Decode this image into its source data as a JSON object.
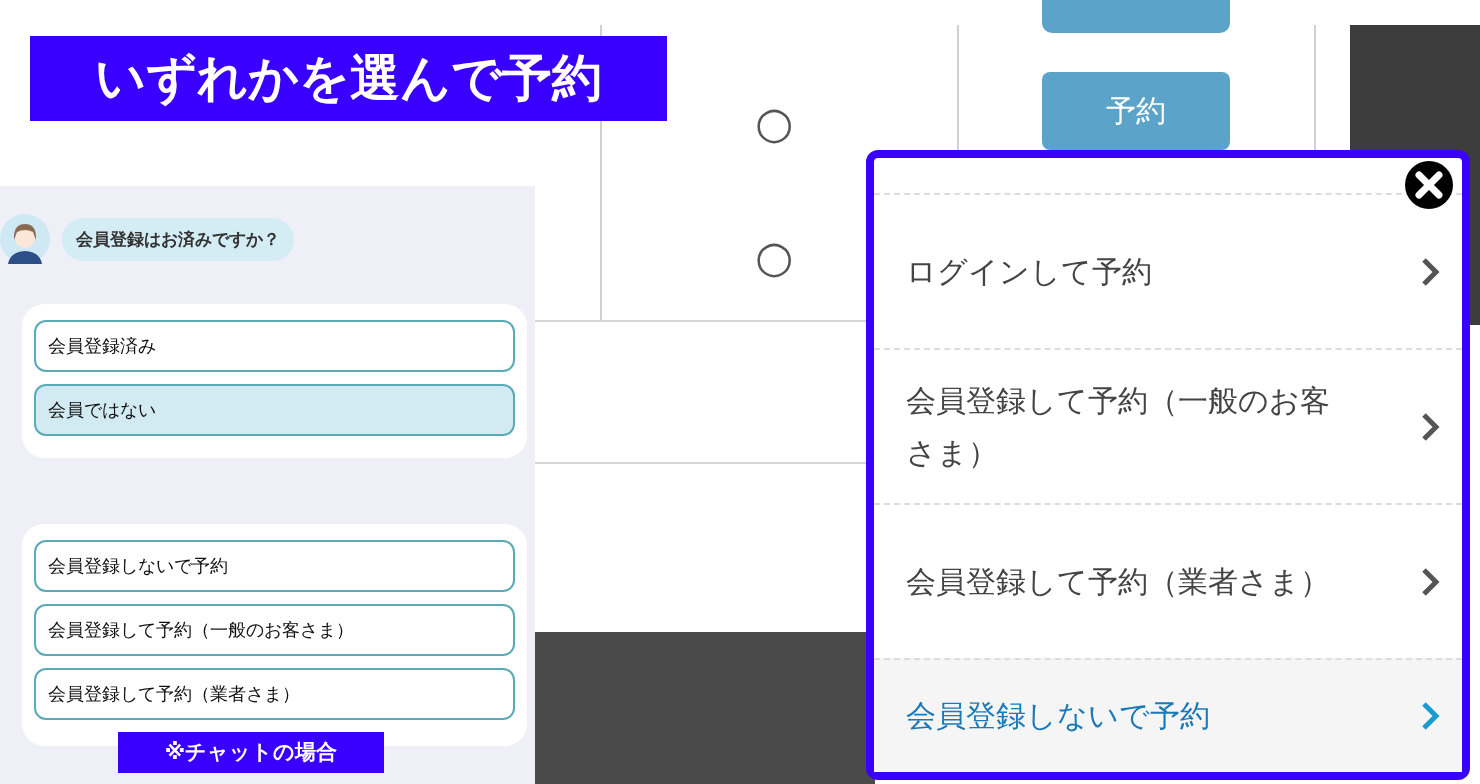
{
  "heading": "いずれかを選んで予約",
  "schedule": {
    "marks": [
      "○",
      "○"
    ],
    "reserve_button": "予約"
  },
  "chat": {
    "question": "会員登録はお済みですか？",
    "groups": [
      [
        {
          "label": "会員登録済み",
          "selected": false
        },
        {
          "label": "会員ではない",
          "selected": true
        }
      ],
      [
        {
          "label": "会員登録しないで予約",
          "selected": false
        },
        {
          "label": "会員登録して予約（一般のお客さま）",
          "selected": false
        },
        {
          "label": "会員登録して予約（業者さま）",
          "selected": false
        }
      ]
    ],
    "caption": "※チャットの場合"
  },
  "popup": {
    "items": [
      {
        "label": "ログインして予約",
        "selected": false
      },
      {
        "label": "会員登録して予約（一般のお客さま）",
        "selected": false
      },
      {
        "label": "会員登録して予約（業者さま）",
        "selected": false
      },
      {
        "label": "会員登録しないで予約",
        "selected": true
      }
    ]
  }
}
